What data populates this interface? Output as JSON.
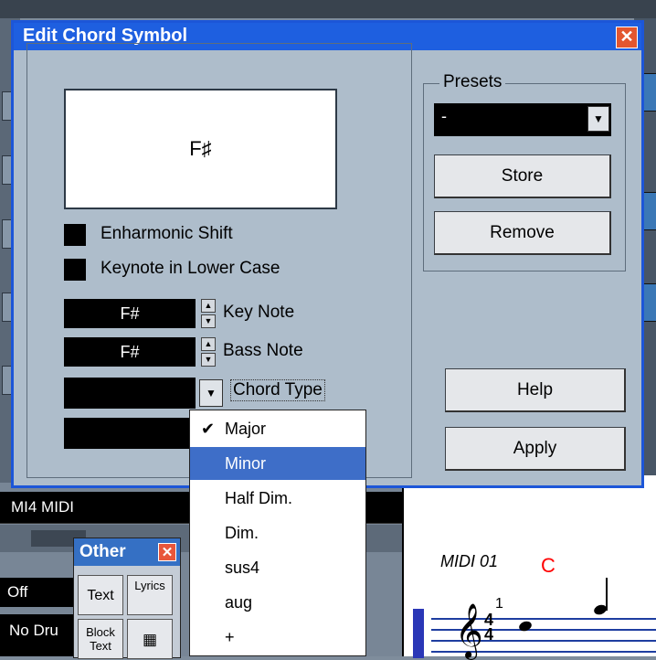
{
  "dialog": {
    "title": "Edit Chord Symbol",
    "close_glyph": "✕",
    "preview_chord": "F♯",
    "enharmonic_label": "Enharmonic Shift",
    "lowercase_label": "Keynote in Lower Case",
    "key_note": {
      "value": "F#",
      "label": "Key Note"
    },
    "bass_note": {
      "value": "F#",
      "label": "Bass Note"
    },
    "chord_type_label": "Chord Type",
    "presets": {
      "legend": "Presets",
      "selected": "-",
      "store_label": "Store",
      "remove_label": "Remove"
    },
    "help_label": "Help",
    "apply_label": "Apply"
  },
  "chord_type_menu": {
    "items": [
      {
        "label": "Major",
        "checked": true
      },
      {
        "label": "Minor",
        "highlighted": true
      },
      {
        "label": "Half Dim."
      },
      {
        "label": "Dim."
      },
      {
        "label": "sus4"
      },
      {
        "label": "aug"
      },
      {
        "label": "+"
      }
    ]
  },
  "background": {
    "midi_track": "MI4 MIDI",
    "off_label": "Off",
    "no_drum_label": "No Dru",
    "score_track": "MIDI 01",
    "score_chord": "C",
    "beat_number": "1",
    "time_signature_top": "4",
    "time_signature_bottom": "4"
  },
  "other_palette": {
    "title": "Other",
    "tools": [
      {
        "label": "Text"
      },
      {
        "label": "Lyrics"
      },
      {
        "label": "Block Text"
      },
      {
        "label": "grid"
      }
    ]
  },
  "colors": {
    "titlebar": "#1e5fe0",
    "dialog_bg": "#aebdcb",
    "highlight": "#3e6ec8",
    "close_red": "#e3562f",
    "score_chord_red": "#ff0000"
  },
  "icons": {
    "spin_up": "up-arrow-icon",
    "spin_down": "down-arrow-icon",
    "combo": "dropdown-arrow-icon",
    "check": "checkmark-icon",
    "close": "close-icon"
  }
}
